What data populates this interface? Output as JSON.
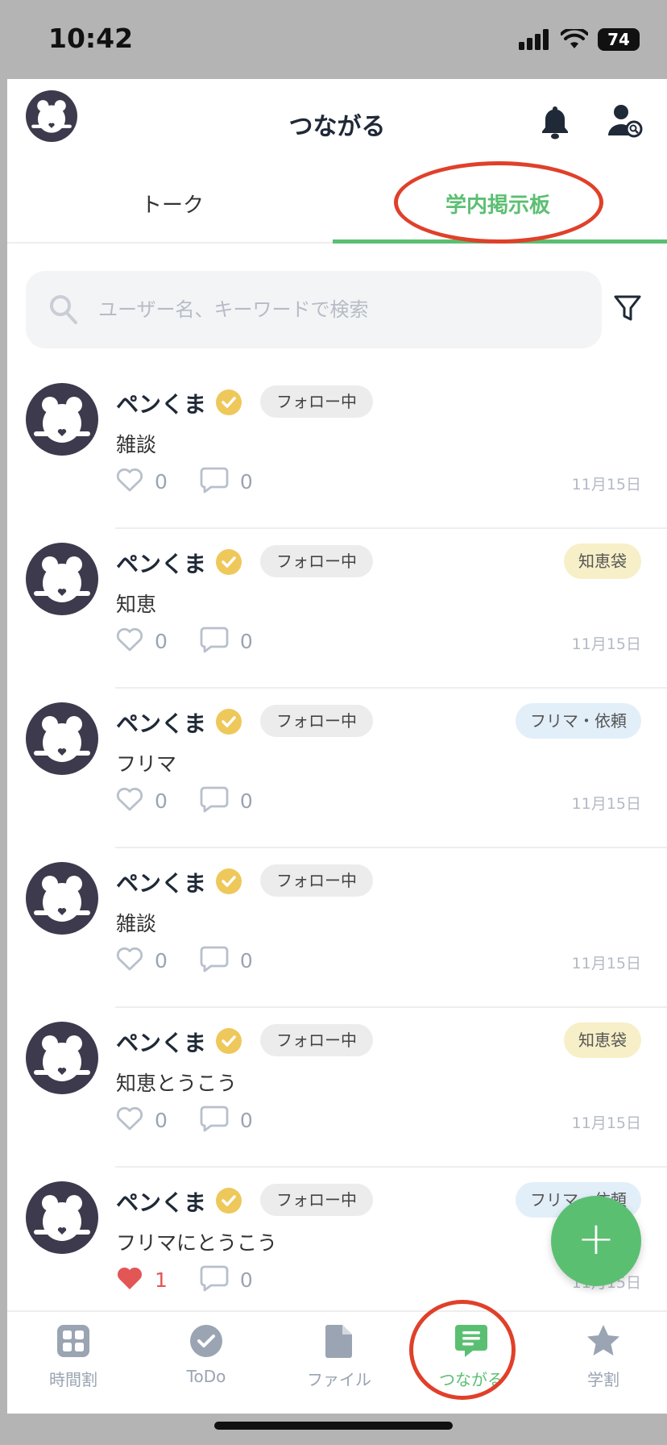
{
  "status_bar": {
    "time": "10:42",
    "battery": "74"
  },
  "header": {
    "title": "つながる"
  },
  "tabs": [
    {
      "label": "トーク"
    },
    {
      "label": "学内掲示板"
    }
  ],
  "search": {
    "placeholder": "ユーザー名、キーワードで検索"
  },
  "posts": [
    {
      "name": "ペンくま",
      "follow": "フォロー中",
      "tag": "",
      "body": "雑談",
      "likes": "0",
      "comments": "0",
      "date": "11月15日",
      "liked": false
    },
    {
      "name": "ペンくま",
      "follow": "フォロー中",
      "tag": "知恵袋",
      "body": "知恵",
      "likes": "0",
      "comments": "0",
      "date": "11月15日",
      "liked": false
    },
    {
      "name": "ペンくま",
      "follow": "フォロー中",
      "tag": "フリマ・依頼",
      "body": "フリマ",
      "likes": "0",
      "comments": "0",
      "date": "11月15日",
      "liked": false
    },
    {
      "name": "ペンくま",
      "follow": "フォロー中",
      "tag": "",
      "body": "雑談",
      "likes": "0",
      "comments": "0",
      "date": "11月15日",
      "liked": false
    },
    {
      "name": "ペンくま",
      "follow": "フォロー中",
      "tag": "知恵袋",
      "body": "知恵とうこう",
      "likes": "0",
      "comments": "0",
      "date": "11月15日",
      "liked": false
    },
    {
      "name": "ペンくま",
      "follow": "フォロー中",
      "tag": "フリマ・依頼",
      "body": "フリマにとうこう",
      "likes": "1",
      "comments": "0",
      "date": "11月15日",
      "liked": true
    }
  ],
  "fab": {
    "label": "+"
  },
  "tabbar": [
    {
      "label": "時間割",
      "icon": "grid-icon"
    },
    {
      "label": "ToDo",
      "icon": "check-circle-icon"
    },
    {
      "label": "ファイル",
      "icon": "file-icon"
    },
    {
      "label": "つながる",
      "icon": "chat-icon",
      "active": true
    },
    {
      "label": "学割",
      "icon": "star-icon"
    }
  ],
  "colors": {
    "accent": "#5bbf72",
    "annotation": "#e0402a",
    "like": "#e25656"
  }
}
